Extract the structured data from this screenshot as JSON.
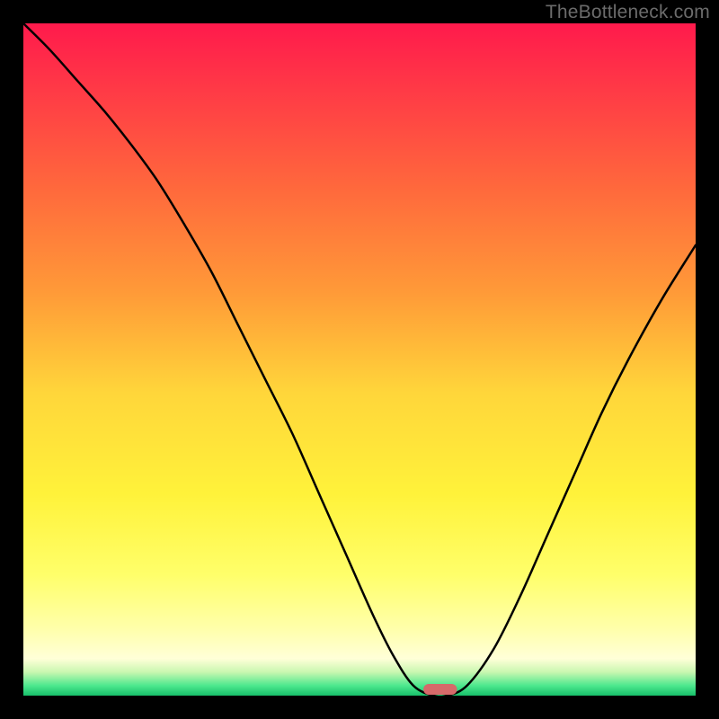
{
  "watermark": "TheBottleneck.com",
  "chart_data": {
    "type": "line",
    "title": "",
    "xlabel": "",
    "ylabel": "",
    "xlim": [
      0,
      100
    ],
    "ylim": [
      0,
      100
    ],
    "background_gradient": [
      {
        "offset": 0.0,
        "color": "#ff1a4c"
      },
      {
        "offset": 0.1,
        "color": "#ff3a46"
      },
      {
        "offset": 0.25,
        "color": "#ff6a3c"
      },
      {
        "offset": 0.4,
        "color": "#ff9a38"
      },
      {
        "offset": 0.55,
        "color": "#ffd63a"
      },
      {
        "offset": 0.7,
        "color": "#fff23a"
      },
      {
        "offset": 0.82,
        "color": "#ffff6a"
      },
      {
        "offset": 0.9,
        "color": "#ffffaa"
      },
      {
        "offset": 0.945,
        "color": "#ffffd8"
      },
      {
        "offset": 0.965,
        "color": "#c9f7b0"
      },
      {
        "offset": 0.985,
        "color": "#4de88e"
      },
      {
        "offset": 1.0,
        "color": "#18c06a"
      }
    ],
    "series": [
      {
        "name": "bottleneck_curve",
        "x": [
          0.0,
          4.0,
          8.0,
          12.0,
          16.0,
          20.0,
          24.0,
          28.0,
          32.0,
          36.0,
          40.0,
          44.0,
          48.0,
          52.0,
          55.0,
          58.0,
          61.0,
          63.0,
          66.0,
          70.0,
          74.0,
          78.0,
          82.0,
          86.0,
          90.0,
          95.0,
          100.0
        ],
        "y": [
          100.0,
          96.0,
          91.5,
          87.0,
          82.0,
          76.5,
          70.0,
          63.0,
          55.0,
          47.0,
          39.0,
          30.0,
          21.0,
          12.0,
          6.0,
          1.5,
          0.0,
          0.0,
          1.5,
          7.0,
          15.0,
          24.0,
          33.0,
          42.0,
          50.0,
          59.0,
          67.0
        ]
      }
    ],
    "optimal_marker": {
      "x_center": 62.0,
      "width": 5.0,
      "color": "#d66a6a"
    }
  }
}
